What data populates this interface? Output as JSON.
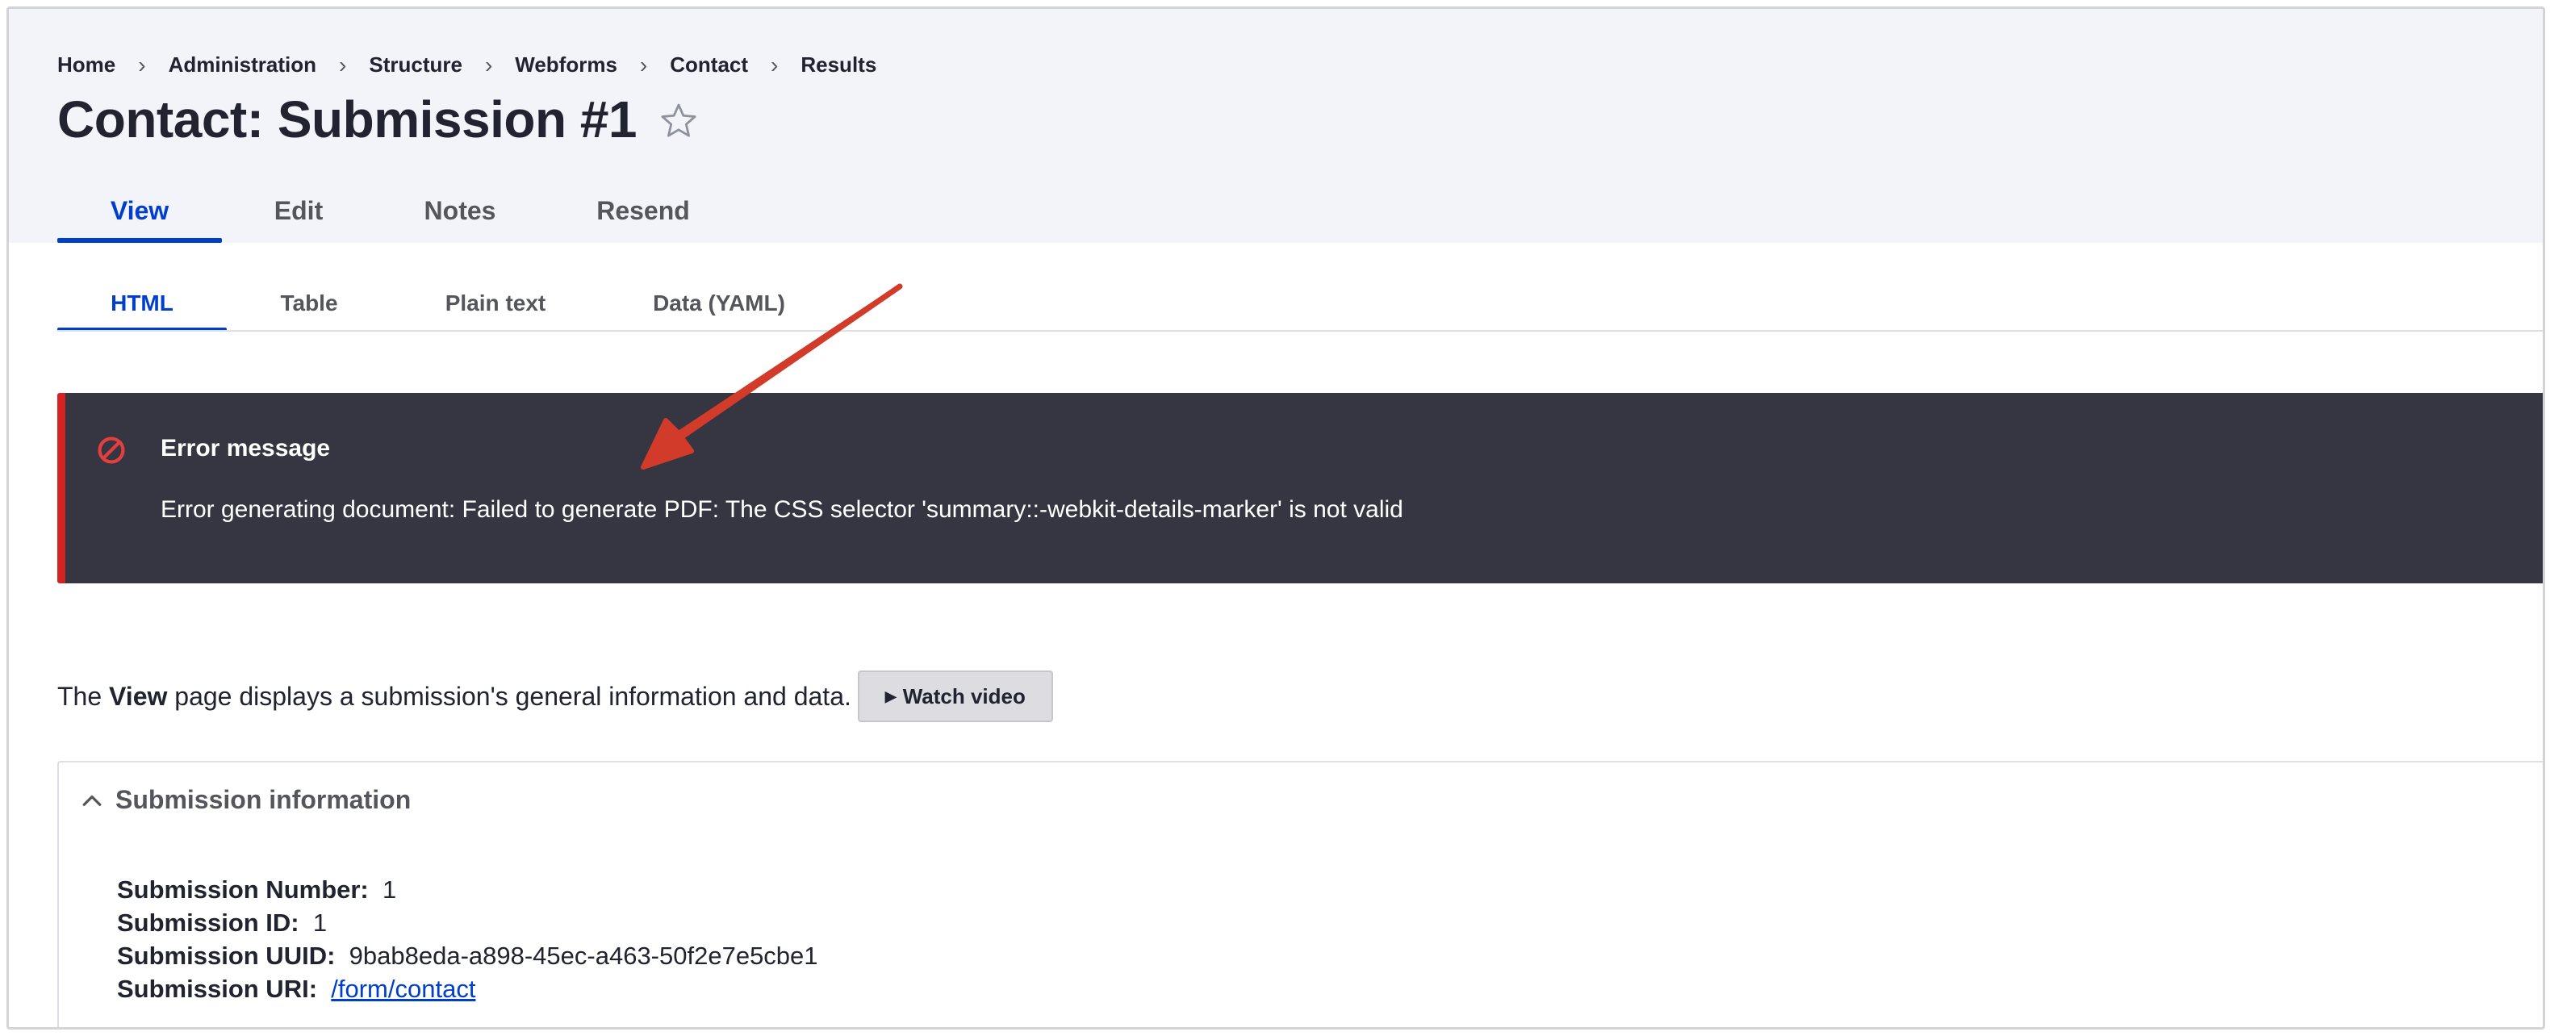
{
  "breadcrumb": [
    "Home",
    "Administration",
    "Structure",
    "Webforms",
    "Contact",
    "Results"
  ],
  "page": {
    "title": "Contact: Submission #1"
  },
  "primary_tabs": [
    {
      "label": "View",
      "active": true
    },
    {
      "label": "Edit",
      "active": false
    },
    {
      "label": "Notes",
      "active": false
    },
    {
      "label": "Resend",
      "active": false
    }
  ],
  "secondary_tabs": [
    {
      "label": "HTML",
      "active": true
    },
    {
      "label": "Table",
      "active": false
    },
    {
      "label": "Plain text",
      "active": false
    },
    {
      "label": "Data (YAML)",
      "active": false
    }
  ],
  "error": {
    "title": "Error message",
    "text": "Error generating document: Failed to generate PDF: The CSS selector 'summary::-webkit-details-marker' is not valid",
    "accent_color": "#d72222"
  },
  "description": {
    "prefix": "The ",
    "emphasis": "View",
    "suffix": " page displays a submission's general information and data.",
    "button_label": "Watch video"
  },
  "submission_info": {
    "summary": "Submission information",
    "rows": [
      {
        "label": "Submission Number:",
        "value": "1"
      },
      {
        "label": "Submission ID:",
        "value": "1"
      },
      {
        "label": "Submission UUID:",
        "value": "9bab8eda-a898-45ec-a463-50f2e7e5cbe1"
      },
      {
        "label": "Submission URI:",
        "value": "/form/contact",
        "link": true
      }
    ]
  },
  "colors": {
    "accent": "#003ecc",
    "header_bg": "#f3f4f9",
    "error_bg": "#353641",
    "annotation_arrow": "#d23a2a"
  }
}
